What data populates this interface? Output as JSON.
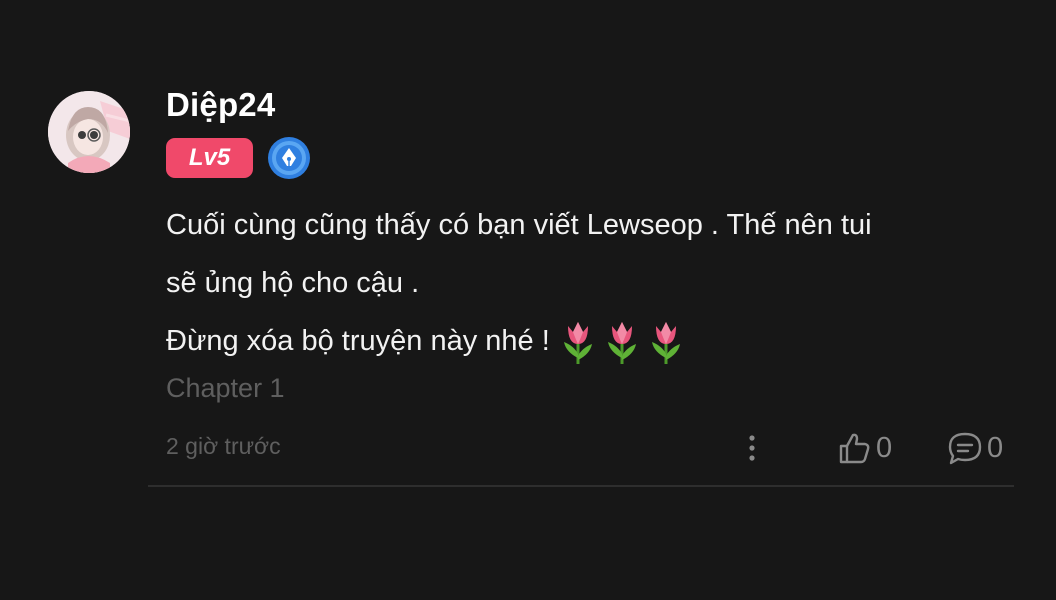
{
  "comment": {
    "username": "Diệp24",
    "level_badge": "Lv5",
    "body_lines": [
      "Cuối cùng cũng thấy có bạn viết Lewseop . Thế nên tui",
      "sẽ ủng hộ cho cậu .",
      "Đừng xóa bộ truyện này nhé !"
    ],
    "emojis": [
      "tulip-icon",
      "tulip-icon",
      "tulip-icon"
    ],
    "chapter": "Chapter 1",
    "timestamp": "2 giờ trước",
    "like_count": "0",
    "reply_count": "0"
  },
  "colors": {
    "background": "#171717",
    "level_badge": "#f0496a",
    "writer_badge": "#2f7fe0",
    "muted_text": "#5f5f5f",
    "divider": "#2e2e2e"
  },
  "icons": {
    "writer_badge": "pen-nib-badge-icon",
    "more": "more-vertical-icon",
    "like": "thumbs-up-icon",
    "reply": "chat-bubble-icon"
  }
}
